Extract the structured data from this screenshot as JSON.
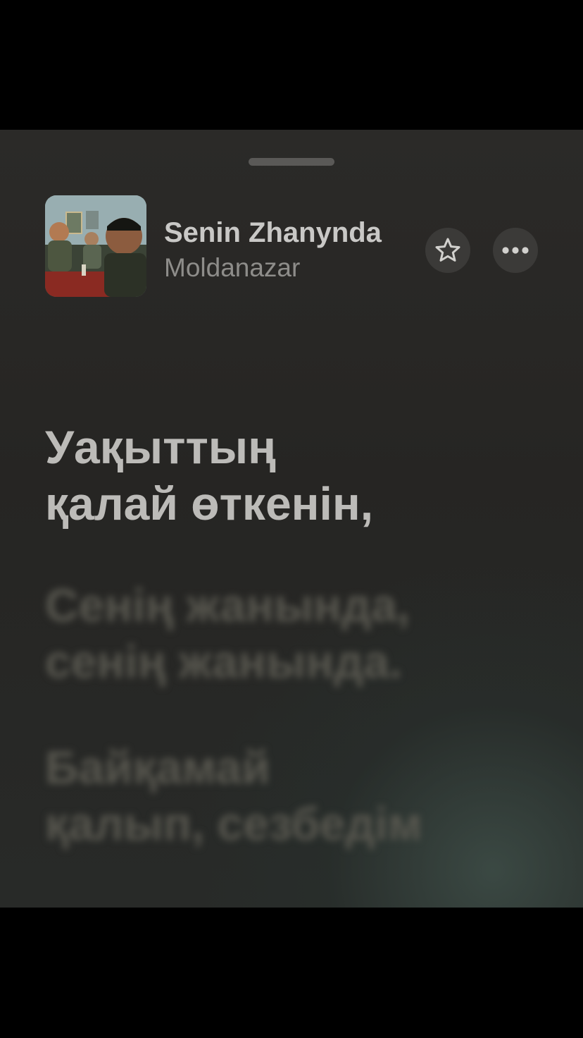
{
  "track": {
    "title": "Senin Zhanynda",
    "artist": "Moldanazar"
  },
  "icons": {
    "favorite": "star-icon",
    "more": "ellipsis-icon",
    "grabber": "sheet-grabber"
  },
  "lyrics": {
    "current": [
      "Уақыттың",
      "қалай өткенін,"
    ],
    "next": [
      "Сенің жанында,",
      "сенің жанында."
    ],
    "later": [
      "Байқамай",
      "қалып, сезбедім"
    ]
  },
  "colors": {
    "sheet_background": "#272624",
    "title_text": "#c9c8c6",
    "artist_text": "#8e8d8a",
    "current_lyric": "#bcbbb8",
    "upcoming_lyric": "#58574f",
    "button_background": "#3b3a38"
  }
}
